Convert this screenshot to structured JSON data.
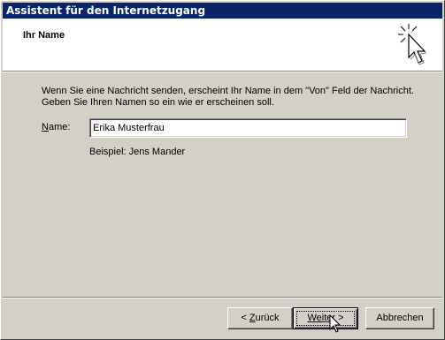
{
  "window": {
    "title": "Assistent für den Internetzugang"
  },
  "header": {
    "title": "Ihr Name",
    "icon": "wizard-cursor-icon"
  },
  "main": {
    "description_line1": "Wenn Sie eine Nachricht senden, erscheint Ihr Name in dem \"Von\" Feld der Nachricht.",
    "description_line2": "Geben Sie Ihren Namen so ein wie er erscheinen soll.",
    "name_label_accel": "N",
    "name_label_rest": "ame:",
    "name_value": "Erika Musterfrau",
    "example_text": "Beispiel: Jens Mander"
  },
  "buttons": {
    "back_prefix": "< ",
    "back_accel": "Z",
    "back_rest": "urück",
    "next_prefix": "Weite",
    "next_rest": "r >",
    "cancel_label": "Abbrechen"
  },
  "colors": {
    "titlebar": "#0a246a",
    "face": "#d4d0c8"
  }
}
